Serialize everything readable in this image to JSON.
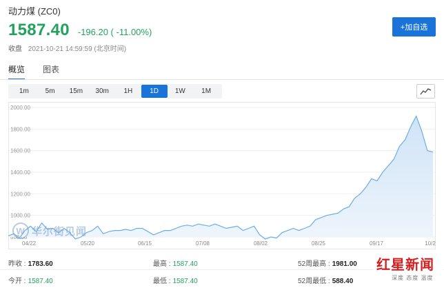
{
  "header": {
    "title": "动力煤 (ZC0)",
    "price": "1587.40",
    "change": "-196.20 ( -11.00%)",
    "status_label": "收盘",
    "timestamp": "2021-10-21 14:59:59 (北京时间)",
    "watch_button": "+加自选"
  },
  "view_tabs": [
    {
      "label": "概览",
      "active": true
    },
    {
      "label": "图表",
      "active": false
    }
  ],
  "ranges": [
    {
      "label": "1m",
      "active": false
    },
    {
      "label": "5m",
      "active": false
    },
    {
      "label": "15m",
      "active": false
    },
    {
      "label": "30m",
      "active": false
    },
    {
      "label": "1H",
      "active": false
    },
    {
      "label": "1D",
      "active": true
    },
    {
      "label": "1W",
      "active": false
    },
    {
      "label": "1M",
      "active": false
    }
  ],
  "chart_type_icon": "line-chart-icon",
  "colors": {
    "up_down_green": "#21a35d",
    "accent_blue": "#1a73d9",
    "area_fill": "#dbeaf7",
    "line": "#6aaee6"
  },
  "chart_data": {
    "type": "area",
    "ylim": [
      800,
      2000
    ],
    "yticks": [
      "2000.00",
      "1800.00",
      "1600.00",
      "1400.00",
      "1200.00",
      "1000.00",
      "800.00"
    ],
    "xticks": [
      "04/22",
      "05/20",
      "06/15",
      "07/08",
      "08/02",
      "08/25",
      "09/17",
      "10/2"
    ],
    "series": [
      {
        "values": [
          810,
          830,
          790,
          860,
          900,
          850,
          930,
          870,
          880,
          840,
          880,
          840,
          780,
          800,
          840,
          860,
          900,
          830,
          850,
          860,
          860,
          870,
          860,
          880,
          880,
          850,
          820,
          840,
          860,
          860,
          880,
          900,
          910,
          900,
          920,
          910,
          900,
          920,
          900,
          880,
          890,
          900,
          860,
          880,
          900,
          820,
          780,
          800,
          790,
          840,
          860,
          880,
          860,
          880,
          900,
          960,
          980,
          1000,
          1010,
          1020,
          1060,
          1080,
          1160,
          1200,
          1260,
          1340,
          1320,
          1400,
          1460,
          1520,
          1640,
          1700,
          1820,
          1920,
          1780,
          1600,
          1587
        ]
      }
    ]
  },
  "watermarks": {
    "left": "华尔街见闻",
    "left_mark": "W",
    "right_logo": "红星新闻",
    "right_tag": "深度 态度 温度"
  },
  "stats": [
    {
      "label": "昨收 :",
      "value": "1783.60",
      "style": "dark"
    },
    {
      "label": "最高 :",
      "value": "1587.40",
      "style": "green"
    },
    {
      "label": "52周最高 :",
      "value": "1981.00",
      "style": "dark"
    },
    {
      "label": "今开 :",
      "value": "1587.40",
      "style": "green"
    },
    {
      "label": "最低 :",
      "value": "1587.40",
      "style": "green"
    },
    {
      "label": "52周最低 :",
      "value": "588.40",
      "style": "dark"
    }
  ]
}
